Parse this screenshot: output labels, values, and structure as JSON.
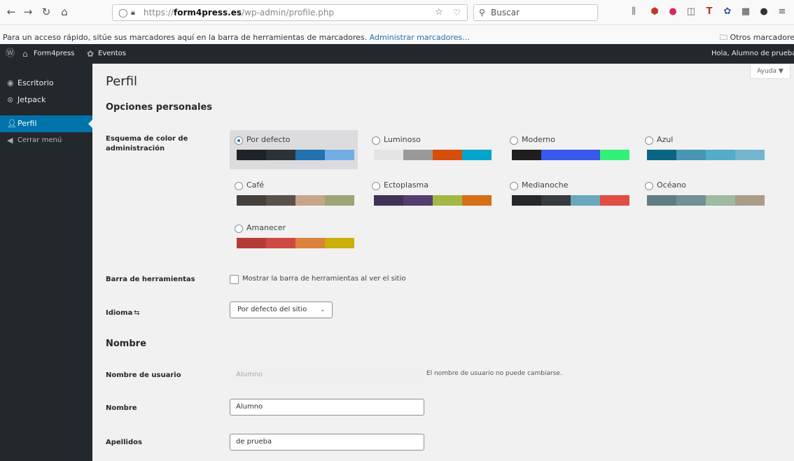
{
  "browser": {
    "url_prefix": "https://",
    "url_domain": "form4press.es",
    "url_path": "/wp-admin/profile.php",
    "search_placeholder": "Buscar",
    "bookmarks_text": "Para un acceso rápido, sitúe sus marcadores aquí en la barra de herramientas de marcadores.",
    "bookmarks_link": "Administrar marcadores…",
    "other_bookmarks": "Otros marcadores"
  },
  "adminbar": {
    "site_name": "Form4press",
    "events": "Eventos",
    "greeting": "Hola, Alumno de prueba"
  },
  "sidebar": {
    "items": [
      {
        "label": "Escritorio"
      },
      {
        "label": "Jetpack"
      },
      {
        "label": "Perfil"
      },
      {
        "label": "Cerrar menú"
      }
    ]
  },
  "main": {
    "help_label": "Ayuda ▼",
    "page_title": "Perfil",
    "personal_options_title": "Opciones personales",
    "color_scheme_label": "Esquema de color de administración",
    "schemes": [
      {
        "name": "Por defecto",
        "colors": [
          "#1d2327",
          "#2c3338",
          "#2271b1",
          "#72aee6"
        ],
        "selected": true
      },
      {
        "name": "Luminoso",
        "colors": [
          "#e5e5e5",
          "#999999",
          "#d64e07",
          "#04a4cc"
        ],
        "selected": false
      },
      {
        "name": "Moderno",
        "colors": [
          "#1e1e1e",
          "#3858e9",
          "#3858e9",
          "#33f078"
        ],
        "selected": false
      },
      {
        "name": "Azul",
        "colors": [
          "#096484",
          "#4796b3",
          "#52accc",
          "#74b6ce"
        ],
        "selected": false
      },
      {
        "name": "Café",
        "colors": [
          "#46403c",
          "#59524c",
          "#c7a589",
          "#9ea476"
        ],
        "selected": false
      },
      {
        "name": "Ectoplasma",
        "colors": [
          "#413256",
          "#523f6d",
          "#a3b745",
          "#d46f15"
        ],
        "selected": false
      },
      {
        "name": "Medianoche",
        "colors": [
          "#25282b",
          "#363b3f",
          "#69a8bb",
          "#e14d43"
        ],
        "selected": false
      },
      {
        "name": "Océano",
        "colors": [
          "#627c83",
          "#738e96",
          "#9ebaa0",
          "#aa9d88"
        ],
        "selected": false
      },
      {
        "name": "Amanecer",
        "colors": [
          "#b43c38",
          "#cf4944",
          "#dd823b",
          "#ccaf0b"
        ],
        "selected": false
      }
    ],
    "toolbar_label": "Barra de herramientas",
    "toolbar_checkbox_label": "Mostrar la barra de herramientas al ver el sitio",
    "language_label": "Idioma",
    "language_value": "Por defecto del sitio",
    "name_title": "Nombre",
    "username_label": "Nombre de usuario",
    "username_value": "Alumno",
    "username_desc": "El nombre de usuario no puede cambiarse.",
    "first_name_label": "Nombre",
    "first_name_value": "Alumno",
    "last_name_label": "Apellidos",
    "last_name_value": "de prueba"
  }
}
